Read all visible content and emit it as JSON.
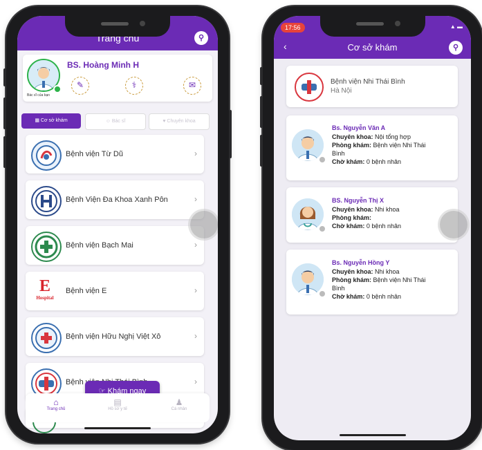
{
  "left": {
    "title": "Trang chủ",
    "doctor": {
      "name": "BS. Hoàng Minh H",
      "caption": "Bác sĩ của bạn"
    },
    "tabs": [
      "Cơ sở khám",
      "Bác sĩ",
      "Chuyên khoa"
    ],
    "hospitals": [
      {
        "name": "Bệnh viện Từ Dũ"
      },
      {
        "name": "Bệnh Viện Đa Khoa Xanh Pôn"
      },
      {
        "name": "Bệnh viện Bạch Mai"
      },
      {
        "name": "Bệnh viện E"
      },
      {
        "name": "Bệnh viện Hữu Nghị Việt Xô"
      },
      {
        "name": "Bệnh viện Nhi Thái Bình"
      }
    ],
    "fab_label": "Khám ngay",
    "nav": [
      {
        "label": "Trang chủ",
        "icon": "home-icon"
      },
      {
        "label": "Hồ sơ y tế",
        "icon": "record-icon"
      },
      {
        "label": "Cá nhân",
        "icon": "person-icon"
      }
    ],
    "logo_e": {
      "letter": "E",
      "caption": "Hospital"
    }
  },
  "right": {
    "time": "17:56",
    "title": "Cơ sở khám",
    "facility": {
      "name": "Bệnh viện Nhi Thái Bình",
      "city": "Hà Nội"
    },
    "labels": {
      "specialty": "Chuyên khoa:",
      "clinic": "Phòng khám:",
      "waiting": "Chờ khám:"
    },
    "doctors": [
      {
        "name": "Bs. Nguyễn Văn A",
        "specialty": "Nội tổng hợp",
        "clinic": "Bệnh viện Nhi Thái",
        "clinic2": "Bình",
        "waiting": "0 bệnh nhân"
      },
      {
        "name": "BS. Nguyễn Thị X",
        "specialty": "Nhi khoa",
        "clinic": "",
        "clinic2": "",
        "waiting": "0 bệnh nhân"
      },
      {
        "name": "Bs. Nguyễn Hồng Y",
        "specialty": "Nhi khoa",
        "clinic": "Bệnh viện Nhi Thái",
        "clinic2": "Bình",
        "waiting": "0 bệnh nhân"
      }
    ]
  },
  "colors": {
    "primary": "#6b2bb5",
    "accent": "#c99a3a",
    "background": "#f3f1f7"
  }
}
